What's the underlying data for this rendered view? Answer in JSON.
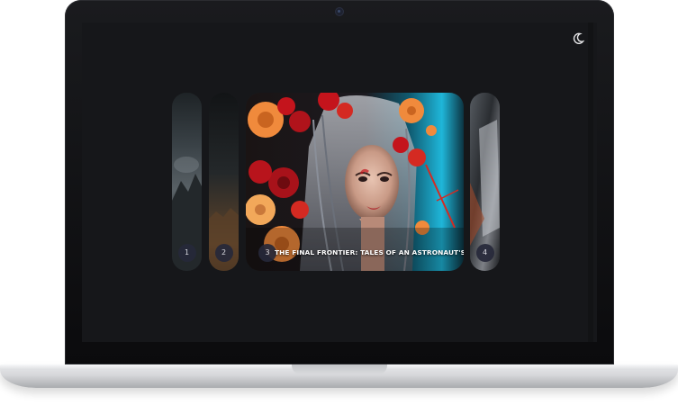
{
  "header": {
    "theme_toggle_icon": "moon-icon"
  },
  "carousel": {
    "slides": [
      {
        "number": "1",
        "image": "stormy-landscape-image"
      },
      {
        "number": "2",
        "image": "desert-landscape-image"
      },
      {
        "number": "3",
        "image": "floral-cyborg-woman-image",
        "title": "THE FINAL FRONTIER: TALES OF AN ASTRONAUT'S ADVENTURES",
        "active": true
      },
      {
        "number": "4",
        "image": "abstract-metal-image"
      }
    ]
  },
  "colors": {
    "screen_background": "#16171a",
    "badge_background": "#26283a",
    "accent_cyan": "#1fb6d9",
    "accent_orange": "#f08a3c",
    "accent_red": "#c4141c"
  }
}
